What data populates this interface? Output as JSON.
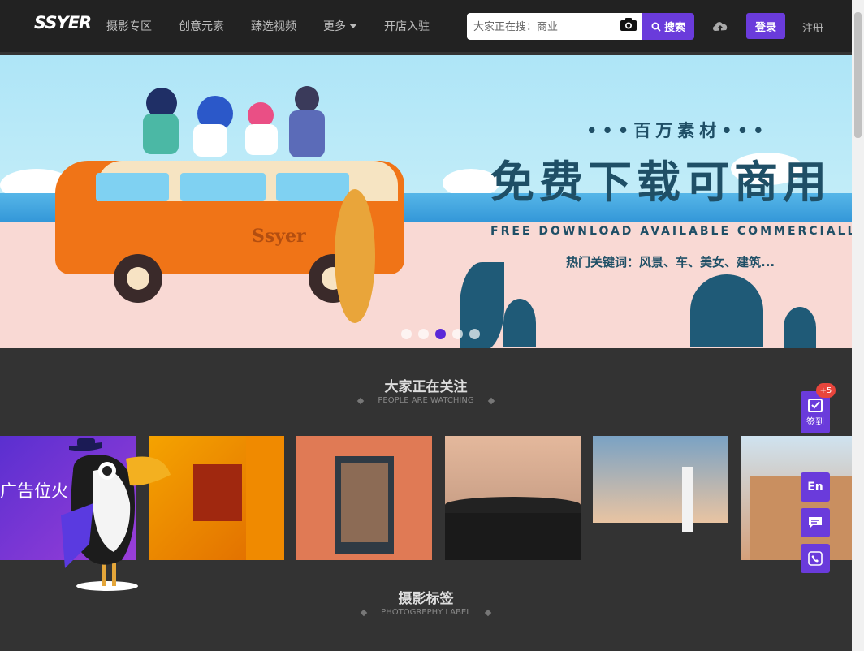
{
  "header": {
    "logo": "SSYER",
    "nav": [
      {
        "label": "摄影专区"
      },
      {
        "label": "创意元素"
      },
      {
        "label": "臻选视频"
      },
      {
        "label": "更多"
      },
      {
        "label": "开店入驻"
      }
    ],
    "search_placeholder": "大家正在搜：商业",
    "search_button": "搜索",
    "login": "登录",
    "register": "注册"
  },
  "banner": {
    "tagline": "•••百万素材•••",
    "headline": "免费下载可商用",
    "english": "FREE DOWNLOAD AVAILABLE COMMERCIALLY",
    "keywords": "热门关键词：风景、车、美女、建筑...",
    "bus_text": "Ssyer",
    "active_slide": 3,
    "slide_count": 5
  },
  "watching": {
    "title": "大家正在关注",
    "subtitle": "PEOPLE ARE WATCHING",
    "first_thumb_text": "广告位火"
  },
  "label_section": {
    "title": "摄影标签",
    "subtitle": "PHOTOGREPHY LABEL"
  },
  "side": {
    "checkin": "签到",
    "checkin_badge": "+5",
    "lang": "En"
  },
  "colors": {
    "accent": "#6a3bdb",
    "header_bg": "#222222",
    "page_bg": "#333333"
  }
}
